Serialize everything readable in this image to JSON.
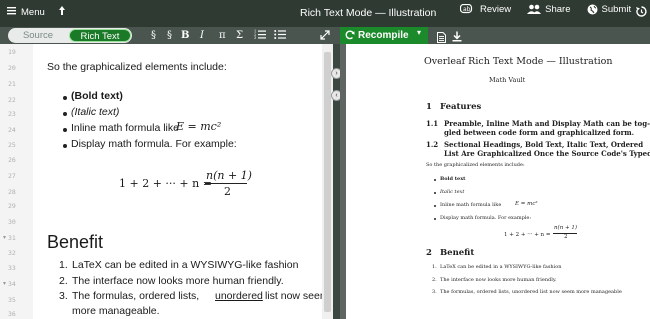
{
  "topbar": {
    "menu_label": "Menu",
    "title": "Rich Text Mode — Illustration",
    "review_label": "Review",
    "share_label": "Share",
    "submit_label": "Submit"
  },
  "toolbar": {
    "source_label": "Source",
    "rich_text_label": "Rich Text",
    "format_buttons": [
      "§",
      "§",
      "B",
      "I",
      "π",
      "Σ"
    ]
  },
  "right_toolbar": {
    "recompile_label": "Recompile"
  },
  "editor": {
    "line_numbers": [
      "19",
      "20",
      "21",
      "22",
      "23",
      "24",
      "25",
      "26",
      "27",
      "28",
      "29",
      "30",
      "31",
      "32",
      "33",
      "34",
      "35",
      "36"
    ],
    "intro": "So the graphicalized elements include:",
    "bullets": [
      "(Bold text)",
      "(Italic text)",
      "Inline math formula like",
      "Display math formula. For example:"
    ],
    "inline_formula": "E = mc²",
    "display_formula_lhs": "1 + 2 + ··· + n =",
    "display_formula_num": "n(n + 1)",
    "display_formula_den": "2",
    "section_heading": "Benefit",
    "list_numbers": [
      "1.",
      "2.",
      "3."
    ],
    "list_items": [
      "LaTeX can be edited in a WYSIWYG-like fashion",
      "The interface now looks more human friendly.",
      "The formulas, ordered lists,",
      "unordered",
      "list now seem",
      "more manageable."
    ]
  },
  "pdf": {
    "title": "Overleaf Rich Text Mode — Illustration",
    "author": "Math Vault",
    "s1_num": "1",
    "s1_title": "Features",
    "ss11_num": "1.1",
    "ss11_line1": "Preamble, Inline Math and Display Math can be tog-",
    "ss11_line2": "gled between code form and graphicalized form.",
    "ss12_num": "1.2",
    "ss12_line1": "Sectional Headings, Bold Text, Italic Text, Ordered",
    "ss12_line2": "List Are Graphicalized Once the Source Code's Typed",
    "intro": "So the graphicalized elements include:",
    "bullets": [
      "Bold text",
      "Italic text",
      "Inline math formula like",
      "Display math formula. For example:"
    ],
    "inline_formula": "E = mc²",
    "display_lhs": "1 + 2 + ··· + n =",
    "display_num": "n(n + 1)",
    "display_den": "2",
    "s2_num": "2",
    "s2_title": "Benefit",
    "list_numbers": [
      "1.",
      "2.",
      "3."
    ],
    "list_items": [
      "LaTeX can be edited in a WYSIWYG-like fashion",
      "The interface now looks more human friendly.",
      "The formulas, ordered lists, unordered list now seem more manageable"
    ]
  },
  "colors": {
    "topbar_bg": "#2f3a32",
    "toolbar_bg": "#4a5550",
    "accent_green": "#1b8a2a",
    "pdf_bg": "#5f6560"
  }
}
